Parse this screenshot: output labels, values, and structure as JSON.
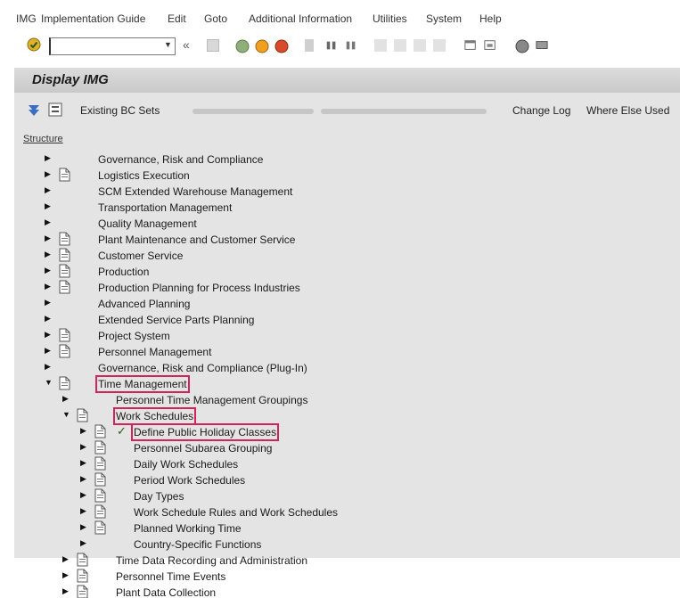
{
  "menu": [
    "IMG",
    "Implementation Guide",
    "Edit",
    "Goto",
    "Additional Information",
    "Utilities",
    "System",
    "Help"
  ],
  "command": {
    "value": "",
    "placeholder": ""
  },
  "title": "Display IMG",
  "app_toolbar": {
    "existing_bc_sets": "Existing BC Sets",
    "change_log": "Change Log",
    "where_else_used": "Where Else Used"
  },
  "structure_label": "Structure",
  "tree": [
    {
      "label": "Governance, Risk and Compliance",
      "level": 0,
      "doc": false,
      "expanded": false
    },
    {
      "label": "Logistics Execution",
      "level": 0,
      "doc": true,
      "expanded": false
    },
    {
      "label": "SCM Extended Warehouse Management",
      "level": 0,
      "doc": false,
      "expanded": false
    },
    {
      "label": "Transportation Management",
      "level": 0,
      "doc": false,
      "expanded": false
    },
    {
      "label": "Quality Management",
      "level": 0,
      "doc": false,
      "expanded": false
    },
    {
      "label": "Plant Maintenance and Customer Service",
      "level": 0,
      "doc": true,
      "expanded": false
    },
    {
      "label": "Customer Service",
      "level": 0,
      "doc": true,
      "expanded": false
    },
    {
      "label": "Production",
      "level": 0,
      "doc": true,
      "expanded": false
    },
    {
      "label": "Production Planning for Process Industries",
      "level": 0,
      "doc": true,
      "expanded": false
    },
    {
      "label": "Advanced Planning",
      "level": 0,
      "doc": false,
      "expanded": false
    },
    {
      "label": "Extended Service Parts Planning",
      "level": 0,
      "doc": false,
      "expanded": false
    },
    {
      "label": "Project System",
      "level": 0,
      "doc": true,
      "expanded": false
    },
    {
      "label": "Personnel Management",
      "level": 0,
      "doc": true,
      "expanded": false
    },
    {
      "label": "Governance, Risk and Compliance (Plug-In)",
      "level": 0,
      "doc": false,
      "expanded": false
    },
    {
      "label": "Time Management",
      "level": 0,
      "doc": true,
      "expanded": true,
      "highlight": true
    },
    {
      "label": "Personnel Time Management Groupings",
      "level": 1,
      "doc": false,
      "expanded": false
    },
    {
      "label": "Work Schedules",
      "level": 1,
      "doc": true,
      "expanded": true,
      "highlight": true
    },
    {
      "label": "Define Public Holiday Classes",
      "level": 2,
      "doc": true,
      "check": true,
      "expanded": false,
      "highlight": true
    },
    {
      "label": "Personnel Subarea Grouping",
      "level": 2,
      "doc": true,
      "expanded": false
    },
    {
      "label": "Daily Work Schedules",
      "level": 2,
      "doc": true,
      "expanded": false
    },
    {
      "label": "Period Work Schedules",
      "level": 2,
      "doc": true,
      "expanded": false
    },
    {
      "label": "Day Types",
      "level": 2,
      "doc": true,
      "expanded": false
    },
    {
      "label": "Work Schedule Rules and Work Schedules",
      "level": 2,
      "doc": true,
      "expanded": false
    },
    {
      "label": "Planned Working Time",
      "level": 2,
      "doc": true,
      "expanded": false
    },
    {
      "label": "Country-Specific Functions",
      "level": 2,
      "doc": false,
      "expanded": false
    },
    {
      "label": "Time Data Recording and Administration",
      "level": 1,
      "doc": true,
      "expanded": false
    },
    {
      "label": "Personnel Time Events",
      "level": 1,
      "doc": true,
      "expanded": false
    },
    {
      "label": "Plant Data Collection",
      "level": 1,
      "doc": true,
      "expanded": false
    }
  ],
  "icons": {
    "ok": "check-circle-icon",
    "doc": "document-page-icon",
    "collapsed": "triangle-right-icon",
    "expanded": "triangle-down-icon",
    "check": "checkmark-icon"
  },
  "colors": {
    "highlight": "#d3245a",
    "panel": "#e4e4e4",
    "title_bar": "#d2d2d2"
  }
}
